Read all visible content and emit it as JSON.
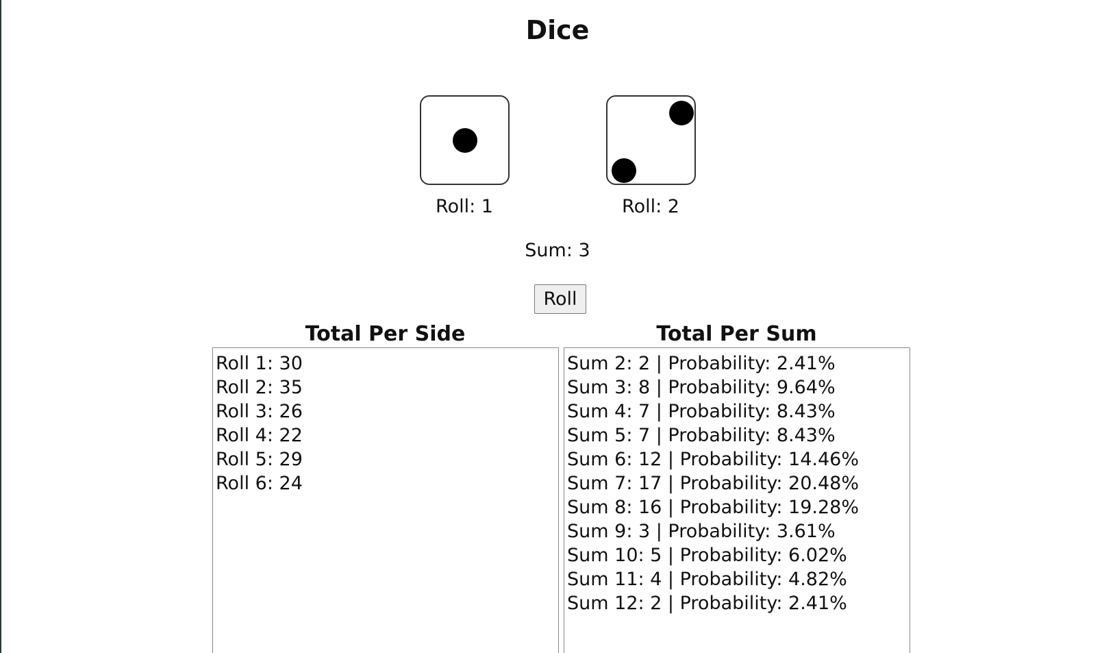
{
  "title": "Dice",
  "dice": [
    {
      "value": 1,
      "label": "Roll: 1"
    },
    {
      "value": 2,
      "label": "Roll: 2"
    }
  ],
  "sum_label": "Sum: 3",
  "roll_button": "Roll",
  "side_panel": {
    "title": "Total Per Side",
    "lines": [
      "Roll 1: 30",
      "Roll 2: 35",
      "Roll 3: 26",
      "Roll 4: 22",
      "Roll 5: 29",
      "Roll 6: 24"
    ]
  },
  "sum_panel": {
    "title": "Total Per Sum",
    "lines": [
      "Sum 2: 2 | Probability: 2.41%",
      "Sum 3: 8 | Probability: 9.64%",
      "Sum 4: 7 | Probability: 8.43%",
      "Sum 5: 7 | Probability: 8.43%",
      "Sum 6: 12 | Probability: 14.46%",
      "Sum 7: 17 | Probability: 20.48%",
      "Sum 8: 16 | Probability: 19.28%",
      "Sum 9: 3 | Probability: 3.61%",
      "Sum 10: 5 | Probability: 6.02%",
      "Sum 11: 4 | Probability: 4.82%",
      "Sum 12: 2 | Probability: 2.41%"
    ]
  }
}
